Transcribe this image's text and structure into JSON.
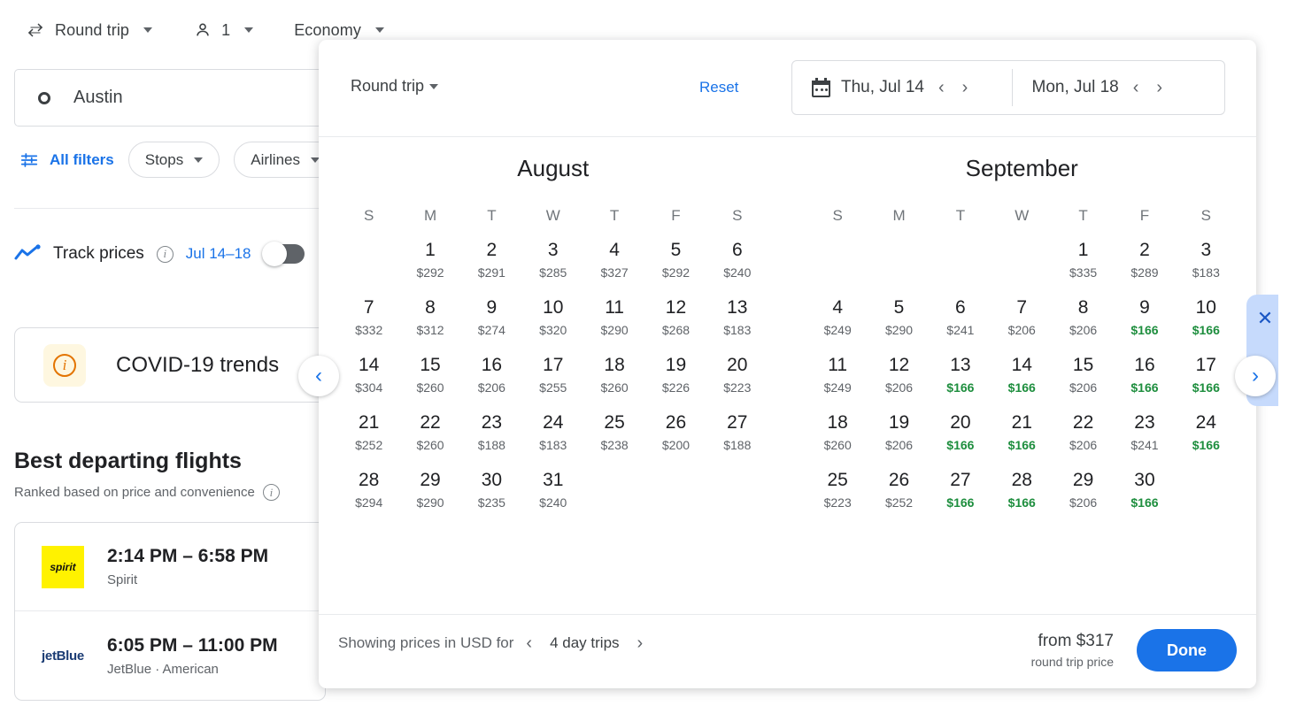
{
  "toolbar": {
    "trip_type": "Round trip",
    "passengers": "1",
    "cabin": "Economy",
    "swap_icon": "swap-horizontal-icon",
    "person_icon": "person-icon"
  },
  "search": {
    "origin_value": "Austin",
    "origin_icon": "circle-outline-icon"
  },
  "filters": {
    "all_filters_label": "All filters",
    "all_filters_icon": "tune-icon",
    "chips": [
      "Stops",
      "Airlines"
    ]
  },
  "track_prices": {
    "icon": "trending-up-icon",
    "label": "Track prices",
    "info_icon": "info-icon",
    "dates": "Jul 14–18",
    "toggle_state": "off"
  },
  "covid_card": {
    "icon": "info-circle-icon",
    "title": "COVID-19 trends"
  },
  "results": {
    "heading": "Best departing flights",
    "subheading": "Ranked based on price and convenience",
    "info_icon": "info-icon",
    "flights": [
      {
        "logo": "spirit-logo",
        "logo_text": "spirit",
        "times": "2:14 PM – 6:58 PM",
        "airlines": "Spirit"
      },
      {
        "logo": "jetblue-logo",
        "logo_text": "jetBlue",
        "times": "6:05 PM – 11:00 PM",
        "airlines": "JetBlue · American"
      }
    ]
  },
  "side_rail": {
    "close_icon": "close-icon",
    "prev_icon": "chevron-left-icon",
    "next_icon": "chevron-right-icon"
  },
  "calendar_modal": {
    "trip_type": "Round trip",
    "reset_label": "Reset",
    "calendar_icon": "calendar-icon",
    "departure_date": "Thu, Jul 14",
    "return_date": "Mon, Jul 18",
    "dep_prev_icon": "chevron-left-icon",
    "dep_next_icon": "chevron-right-icon",
    "ret_prev_icon": "chevron-left-icon",
    "ret_next_icon": "chevron-right-icon",
    "weekdays": [
      "S",
      "M",
      "T",
      "W",
      "T",
      "F",
      "S"
    ],
    "cheap_price_color": "#1e8e3e",
    "accent_color": "#1a73e8",
    "months": [
      {
        "name": "August",
        "lead_blanks": 1,
        "days": [
          {
            "day": "1",
            "price": "$292",
            "cheap": false
          },
          {
            "day": "2",
            "price": "$291",
            "cheap": false
          },
          {
            "day": "3",
            "price": "$285",
            "cheap": false
          },
          {
            "day": "4",
            "price": "$327",
            "cheap": false
          },
          {
            "day": "5",
            "price": "$292",
            "cheap": false
          },
          {
            "day": "6",
            "price": "$240",
            "cheap": false
          },
          {
            "day": "7",
            "price": "$332",
            "cheap": false
          },
          {
            "day": "8",
            "price": "$312",
            "cheap": false
          },
          {
            "day": "9",
            "price": "$274",
            "cheap": false
          },
          {
            "day": "10",
            "price": "$320",
            "cheap": false
          },
          {
            "day": "11",
            "price": "$290",
            "cheap": false
          },
          {
            "day": "12",
            "price": "$268",
            "cheap": false
          },
          {
            "day": "13",
            "price": "$183",
            "cheap": false
          },
          {
            "day": "14",
            "price": "$304",
            "cheap": false
          },
          {
            "day": "15",
            "price": "$260",
            "cheap": false
          },
          {
            "day": "16",
            "price": "$206",
            "cheap": false
          },
          {
            "day": "17",
            "price": "$255",
            "cheap": false
          },
          {
            "day": "18",
            "price": "$260",
            "cheap": false
          },
          {
            "day": "19",
            "price": "$226",
            "cheap": false
          },
          {
            "day": "20",
            "price": "$223",
            "cheap": false
          },
          {
            "day": "21",
            "price": "$252",
            "cheap": false
          },
          {
            "day": "22",
            "price": "$260",
            "cheap": false
          },
          {
            "day": "23",
            "price": "$188",
            "cheap": false
          },
          {
            "day": "24",
            "price": "$183",
            "cheap": false
          },
          {
            "day": "25",
            "price": "$238",
            "cheap": false
          },
          {
            "day": "26",
            "price": "$200",
            "cheap": false
          },
          {
            "day": "27",
            "price": "$188",
            "cheap": false
          },
          {
            "day": "28",
            "price": "$294",
            "cheap": false
          },
          {
            "day": "29",
            "price": "$290",
            "cheap": false
          },
          {
            "day": "30",
            "price": "$235",
            "cheap": false
          },
          {
            "day": "31",
            "price": "$240",
            "cheap": false
          }
        ]
      },
      {
        "name": "September",
        "lead_blanks": 4,
        "days": [
          {
            "day": "1",
            "price": "$335",
            "cheap": false
          },
          {
            "day": "2",
            "price": "$289",
            "cheap": false
          },
          {
            "day": "3",
            "price": "$183",
            "cheap": false
          },
          {
            "day": "4",
            "price": "$249",
            "cheap": false
          },
          {
            "day": "5",
            "price": "$290",
            "cheap": false
          },
          {
            "day": "6",
            "price": "$241",
            "cheap": false
          },
          {
            "day": "7",
            "price": "$206",
            "cheap": false
          },
          {
            "day": "8",
            "price": "$206",
            "cheap": false
          },
          {
            "day": "9",
            "price": "$166",
            "cheap": true
          },
          {
            "day": "10",
            "price": "$166",
            "cheap": true
          },
          {
            "day": "11",
            "price": "$249",
            "cheap": false
          },
          {
            "day": "12",
            "price": "$206",
            "cheap": false
          },
          {
            "day": "13",
            "price": "$166",
            "cheap": true
          },
          {
            "day": "14",
            "price": "$166",
            "cheap": true
          },
          {
            "day": "15",
            "price": "$206",
            "cheap": false
          },
          {
            "day": "16",
            "price": "$166",
            "cheap": true
          },
          {
            "day": "17",
            "price": "$166",
            "cheap": true
          },
          {
            "day": "18",
            "price": "$260",
            "cheap": false
          },
          {
            "day": "19",
            "price": "$206",
            "cheap": false
          },
          {
            "day": "20",
            "price": "$166",
            "cheap": true
          },
          {
            "day": "21",
            "price": "$166",
            "cheap": true
          },
          {
            "day": "22",
            "price": "$206",
            "cheap": false
          },
          {
            "day": "23",
            "price": "$241",
            "cheap": false
          },
          {
            "day": "24",
            "price": "$166",
            "cheap": true
          },
          {
            "day": "25",
            "price": "$223",
            "cheap": false
          },
          {
            "day": "26",
            "price": "$252",
            "cheap": false
          },
          {
            "day": "27",
            "price": "$166",
            "cheap": true
          },
          {
            "day": "28",
            "price": "$166",
            "cheap": true
          },
          {
            "day": "29",
            "price": "$206",
            "cheap": false
          },
          {
            "day": "30",
            "price": "$166",
            "cheap": true
          }
        ]
      }
    ],
    "footer": {
      "currency_label": "Showing prices in USD for",
      "trip_length": "4 day trips",
      "prev_icon": "chevron-left-icon",
      "next_icon": "chevron-right-icon",
      "from_price": "from $317",
      "from_price_sub": "round trip price",
      "done_label": "Done"
    }
  }
}
